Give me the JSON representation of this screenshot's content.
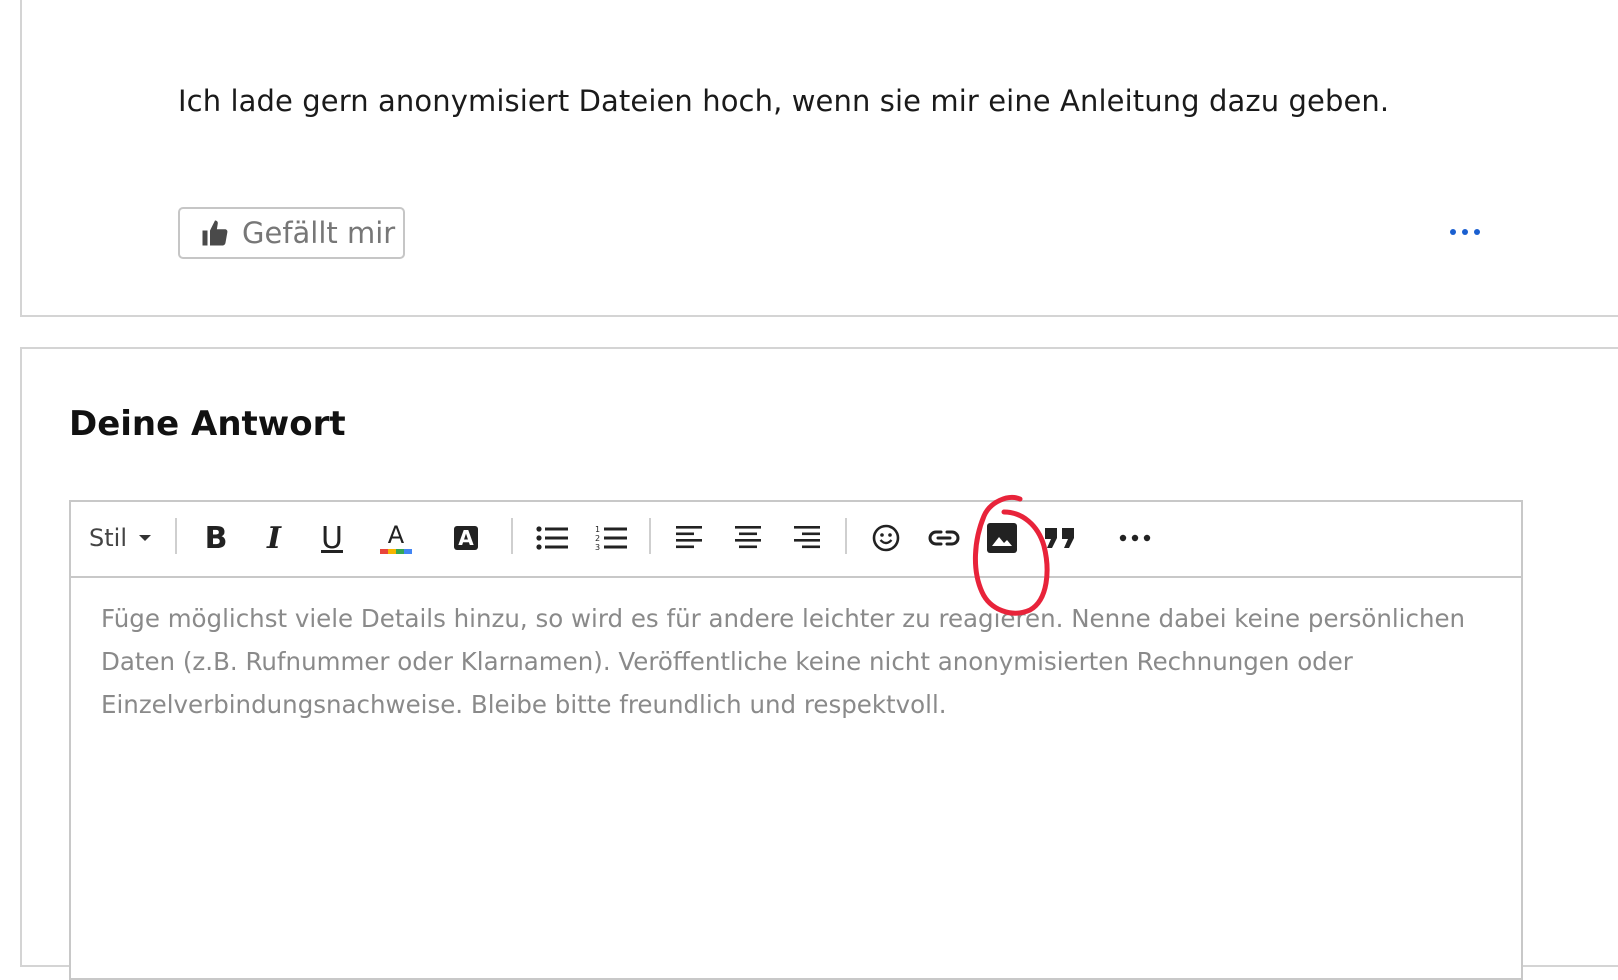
{
  "post": {
    "text": "Ich lade gern anonymisiert Dateien hoch, wenn sie mir eine Anleitung dazu geben.",
    "like_button_label": "Gefällt mir",
    "icons": {
      "like": "thumbs-up-icon",
      "more": "more-horizontal-icon"
    }
  },
  "reply": {
    "heading": "Deine Antwort",
    "toolbar": {
      "style_label": "Stil",
      "bold_label": "B",
      "italic_label": "I",
      "underline_label": "U",
      "font_color_label": "A",
      "background_color_label": "A",
      "icons": [
        "chevron-down-icon",
        "bold-icon",
        "italic-icon",
        "underline-icon",
        "font-color-icon",
        "background-color-icon",
        "bulleted-list-icon",
        "numbered-list-icon",
        "align-left-icon",
        "align-center-icon",
        "align-right-icon",
        "emoji-icon",
        "link-icon",
        "image-icon",
        "blockquote-icon",
        "more-horizontal-icon"
      ]
    },
    "placeholder_lines": [
      "Füge möglichst viele Details hinzu, so wird es für andere leichter zu reagieren. Nenne dabei keine persönlichen",
      "Daten (z.B. Rufnummer oder Klarnamen). Veröffentliche keine nicht anonymisierten Rechnungen oder",
      "Einzelverbindungsnachweise. Bleibe bitte freundlich und respektvoll."
    ]
  },
  "colors": {
    "accent_blue": "#1a5fd0",
    "annotation_red": "#e8233a",
    "border": "#d4d4d4",
    "placeholder": "#8a8a8a"
  }
}
